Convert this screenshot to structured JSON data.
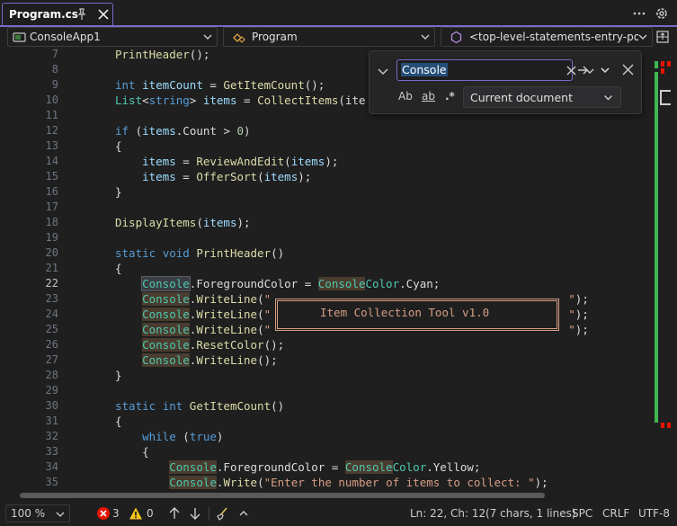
{
  "tab": {
    "title": "Program.cs"
  },
  "nav": {
    "project": "ConsoleApp1",
    "class": "Program",
    "member": "<top-level-statements-entry-point>"
  },
  "find": {
    "query": "Console",
    "options": {
      "match_case": "Ab",
      "whole_word": "ab",
      "regex": ".*"
    },
    "scope": "Current document"
  },
  "code": {
    "line_numbers": [
      "7",
      "8",
      "9",
      "10",
      "11",
      "12",
      "13",
      "14",
      "15",
      "16",
      "17",
      "18",
      "19",
      "20",
      "21",
      "22",
      "23",
      "24",
      "25",
      "26",
      "27",
      "28",
      "29",
      "30",
      "31",
      "32",
      "33",
      "34",
      "35"
    ],
    "current_line": "22",
    "banner_text": "Item Collection Tool v1.0"
  },
  "status": {
    "zoom": "100 %",
    "errors": "3",
    "warnings": "0",
    "position": "Ln: 22, Ch: 12",
    "selection": "(7 chars, 1 lines)",
    "whitespace": "SPC",
    "line_ending": "CRLF",
    "encoding": "UTF-8"
  },
  "colors": {
    "accent": "#7b68c8",
    "keyword": "#569cd6",
    "type": "#4ec9b0",
    "string": "#d69d85",
    "error": "#e51400",
    "warning": "#f5c518"
  }
}
